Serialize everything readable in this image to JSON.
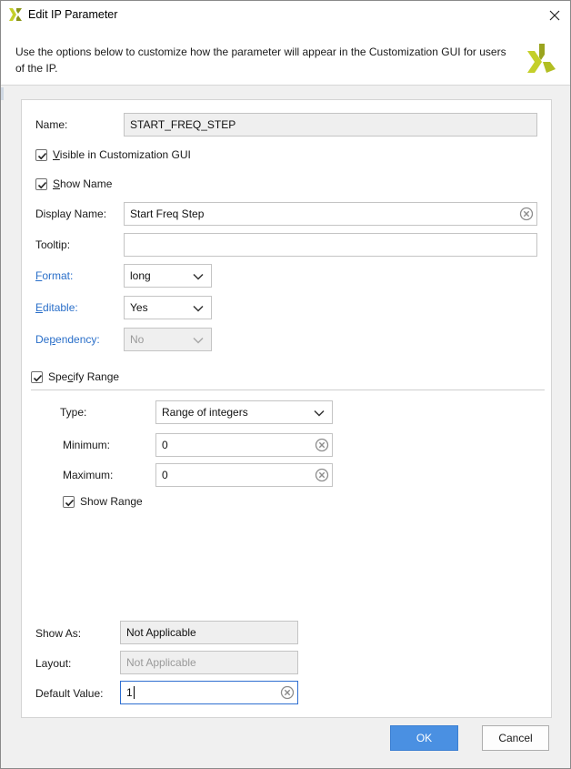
{
  "window": {
    "title": "Edit IP Parameter"
  },
  "header": {
    "description": "Use the options below to customize how the parameter will appear in the Customization GUI for users of the IP."
  },
  "form": {
    "name": {
      "label": "Name:",
      "value": "START_FREQ_STEP"
    },
    "visible_gui": {
      "label_accel": "V",
      "label_rest": "isible in Customization GUI",
      "checked": true
    },
    "show_name": {
      "label_accel": "S",
      "label_rest": "how Name",
      "checked": true
    },
    "display_name": {
      "label": "Display Name:",
      "value": "Start Freq Step"
    },
    "tooltip": {
      "label": "Tooltip:",
      "value": ""
    },
    "format": {
      "label_accel": "F",
      "label_rest": "ormat:",
      "value": "long"
    },
    "editable": {
      "label_accel": "E",
      "label_rest": "ditable:",
      "value": "Yes"
    },
    "dependency": {
      "label_pre": "De",
      "label_accel": "p",
      "label_rest": "endency:",
      "value": "No"
    },
    "specify_range": {
      "label_pre": "Spe",
      "label_accel": "c",
      "label_rest": "ify Range",
      "checked": true
    },
    "range": {
      "type": {
        "label": "Type:",
        "value": "Range of integers"
      },
      "minimum": {
        "label": "Minimum:",
        "value": "0"
      },
      "maximum": {
        "label": "Maximum:",
        "value": "0"
      },
      "show_range": {
        "label": "Show Range",
        "checked": true
      }
    },
    "show_as": {
      "label": "Show As:",
      "value": "Not Applicable"
    },
    "layout": {
      "label": "Layout:",
      "value": "Not Applicable"
    },
    "default_value": {
      "label": "Default Value:",
      "value": "1"
    }
  },
  "footer": {
    "ok_label": "OK",
    "cancel_label": "Cancel"
  },
  "icons": {
    "app": "xilinx-logo-icon",
    "close": "close-icon",
    "clear": "clear-icon",
    "dropdown": "chevron-down-icon",
    "check": "checkmark-icon"
  },
  "colors": {
    "accent": "#4a90e2",
    "link_label": "#2a6fc9",
    "brand_logo": "#b6c21f"
  }
}
